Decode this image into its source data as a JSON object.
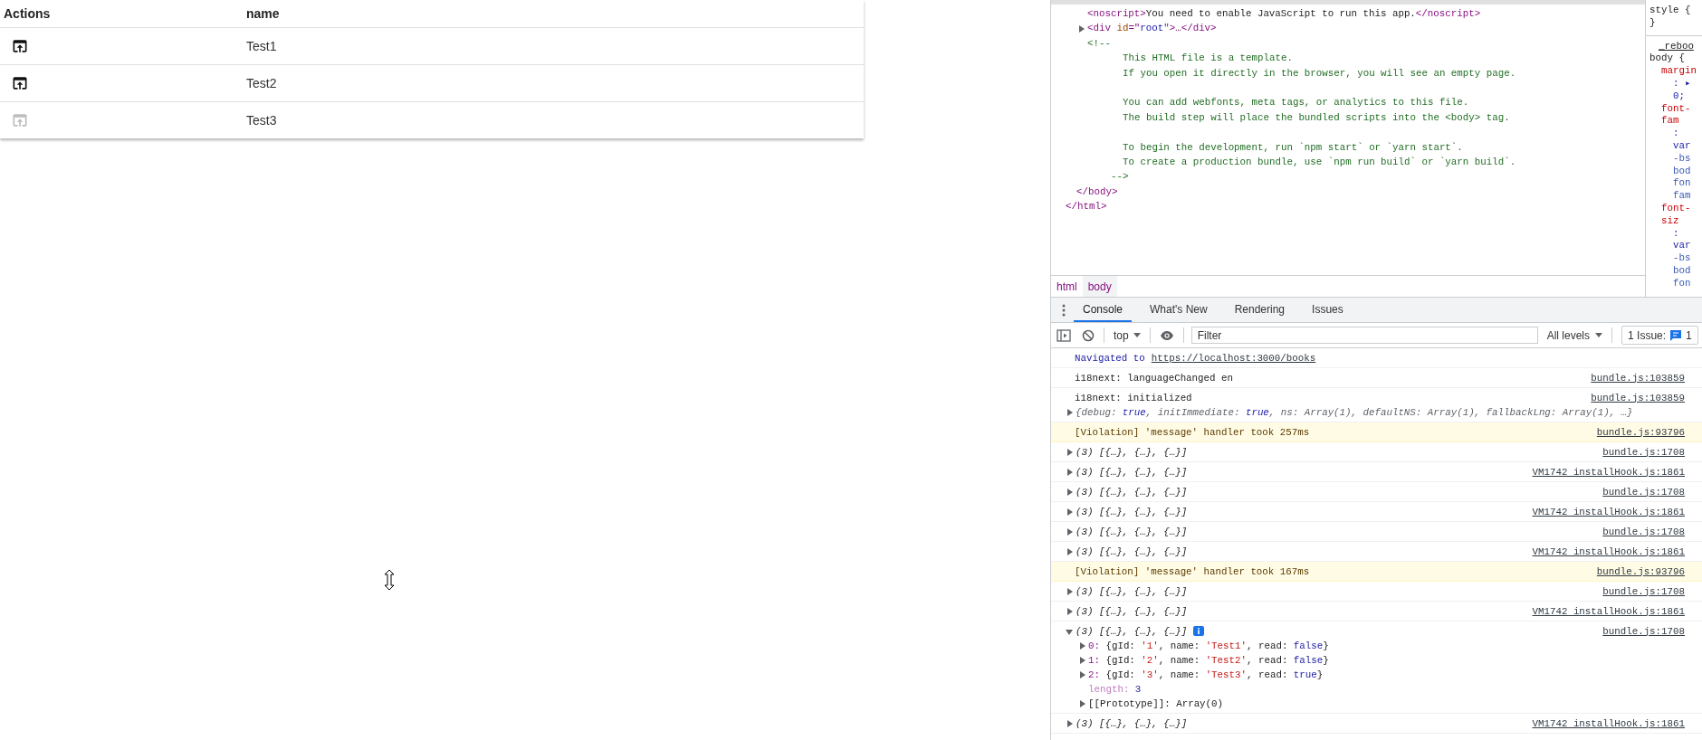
{
  "table": {
    "columns": [
      "Actions",
      "name"
    ],
    "rows": [
      {
        "name": "Test1",
        "action_disabled": false
      },
      {
        "name": "Test2",
        "action_disabled": false
      },
      {
        "name": "Test3",
        "action_disabled": true
      }
    ]
  },
  "elements": {
    "tree": [
      {
        "kind": "group",
        "children": [
          {
            "kind": "group",
            "children": [
              {
                "kind": "element",
                "parts": [
                  {
                    "kind": "tag",
                    "text": "<noscript>"
                  },
                  {
                    "kind": "text",
                    "text": "You need to enable JavaScript to run this app."
                  },
                  {
                    "kind": "tag",
                    "text": "</noscript>"
                  }
                ]
              },
              {
                "kind": "element",
                "expanded": false,
                "parts": [
                  {
                    "kind": "tag",
                    "text": "<div"
                  },
                  {
                    "kind": "attr",
                    "text": " id"
                  },
                  {
                    "kind": "tag",
                    "text": "=\""
                  },
                  {
                    "kind": "value",
                    "text": "root"
                  },
                  {
                    "kind": "tag",
                    "text": "\">…</div>"
                  }
                ]
              },
              {
                "kind": "comment",
                "open": "<!--",
                "paragraphs": [
                  [
                    "This HTML file is a template.",
                    "If you open it directly in the browser, you will see an empty page."
                  ],
                  [
                    "You can add webfonts, meta tags, or analytics to this file.",
                    "The build step will place the bundled scripts into the <body> tag."
                  ],
                  [
                    "To begin the development, run `npm start` or `yarn start`.",
                    "To create a production bundle, use `npm run build` or `yarn build`."
                  ]
                ],
                "close": "-->"
              }
            ]
          },
          {
            "kind": "close",
            "text": "</body>"
          }
        ]
      },
      {
        "kind": "close",
        "text": "</html>"
      }
    ]
  },
  "breadcrumbs": [
    {
      "label": "html",
      "selected": false
    },
    {
      "label": "body",
      "selected": true
    }
  ],
  "styles": [
    {
      "kind": "selector",
      "text": "style {"
    },
    {
      "kind": "selector",
      "text": "}"
    },
    {
      "kind": "source",
      "text": "_reboo"
    },
    {
      "kind": "selector",
      "text": "body {"
    },
    {
      "kind": "prop",
      "text": "margin"
    },
    {
      "kind": "value",
      "text": ": ▸"
    },
    {
      "kind": "value",
      "text": "0;"
    },
    {
      "kind": "prop",
      "text": "font-"
    },
    {
      "kind": "prop",
      "text": "fam"
    },
    {
      "kind": "value",
      "text": ":"
    },
    {
      "kind": "value",
      "text": "var"
    },
    {
      "kind": "var",
      "text": "-bs"
    },
    {
      "kind": "var",
      "text": "bod"
    },
    {
      "kind": "var",
      "text": "fon"
    },
    {
      "kind": "var",
      "text": "fam"
    },
    {
      "kind": "prop",
      "text": "font-"
    },
    {
      "kind": "prop",
      "text": "siz"
    },
    {
      "kind": "value",
      "text": ":"
    },
    {
      "kind": "value",
      "text": "var"
    },
    {
      "kind": "var",
      "text": "-bs"
    },
    {
      "kind": "var",
      "text": "bod"
    },
    {
      "kind": "var",
      "text": "fon"
    }
  ],
  "drawer_tabs": [
    {
      "label": "Console",
      "selected": true
    },
    {
      "label": "What's New",
      "selected": false
    },
    {
      "label": "Rendering",
      "selected": false
    },
    {
      "label": "Issues",
      "selected": false
    }
  ],
  "console_toolbar": {
    "context": "top",
    "filter_placeholder": "Filter",
    "levels": "All levels",
    "issues_label": "1 Issue:",
    "issues_count": "1"
  },
  "console": [
    {
      "kind": "navigation",
      "text": "Navigated to",
      "link": "https://localhost:3000/books"
    },
    {
      "kind": "log",
      "text": "i18next: languageChanged en",
      "source": "bundle.js:103859"
    },
    {
      "kind": "log",
      "text": "i18next: initialized",
      "source": "bundle.js:103859",
      "object": {
        "text": "{debug: true, initImmediate: true, ns: Array(1), defaultNS: Array(1), fallbackLng: Array(1), …}",
        "expanded": false
      }
    },
    {
      "kind": "violation",
      "text": "[Violation] 'message' handler took 257ms",
      "source": "bundle.js:93796"
    },
    {
      "kind": "array",
      "summary": "(3) [{…}, {…}, {…}]",
      "source": "bundle.js:1708",
      "expanded": false
    },
    {
      "kind": "array",
      "summary": "(3) [{…}, {…}, {…}]",
      "source": "VM1742 installHook.js:1861",
      "expanded": false
    },
    {
      "kind": "array",
      "summary": "(3) [{…}, {…}, {…}]",
      "source": "bundle.js:1708",
      "expanded": false
    },
    {
      "kind": "array",
      "summary": "(3) [{…}, {…}, {…}]",
      "source": "VM1742 installHook.js:1861",
      "expanded": false
    },
    {
      "kind": "array",
      "summary": "(3) [{…}, {…}, {…}]",
      "source": "bundle.js:1708",
      "expanded": false
    },
    {
      "kind": "array",
      "summary": "(3) [{…}, {…}, {…}]",
      "source": "VM1742 installHook.js:1861",
      "expanded": false
    },
    {
      "kind": "violation",
      "text": "[Violation] 'message' handler took 167ms",
      "source": "bundle.js:93796"
    },
    {
      "kind": "array",
      "summary": "(3) [{…}, {…}, {…}]",
      "source": "bundle.js:1708",
      "expanded": false
    },
    {
      "kind": "array",
      "summary": "(3) [{…}, {…}, {…}]",
      "source": "VM1742 installHook.js:1861",
      "expanded": false
    },
    {
      "kind": "array",
      "summary": "(3) [{…}, {…}, {…}]",
      "source": "bundle.js:1708",
      "expanded": true,
      "properties": [
        {
          "kind": "index",
          "key": "0:",
          "value": "{gId: '1', name: 'Test1', read: false}",
          "expanded": false
        },
        {
          "kind": "index",
          "key": "1:",
          "value": "{gId: '2', name: 'Test2', read: false}",
          "expanded": false
        },
        {
          "kind": "index",
          "key": "2:",
          "value": "{gId: '3', name: 'Test3', read: true}",
          "expanded": false
        },
        {
          "kind": "meta",
          "key": "length:",
          "value": "3"
        },
        {
          "kind": "internal",
          "key": "[[Prototype]]:",
          "value": "Array(0)",
          "expanded": false
        }
      ]
    },
    {
      "kind": "array",
      "summary": "(3) [{…}, {…}, {…}]",
      "source": "VM1742 installHook.js:1861",
      "expanded": false
    }
  ]
}
